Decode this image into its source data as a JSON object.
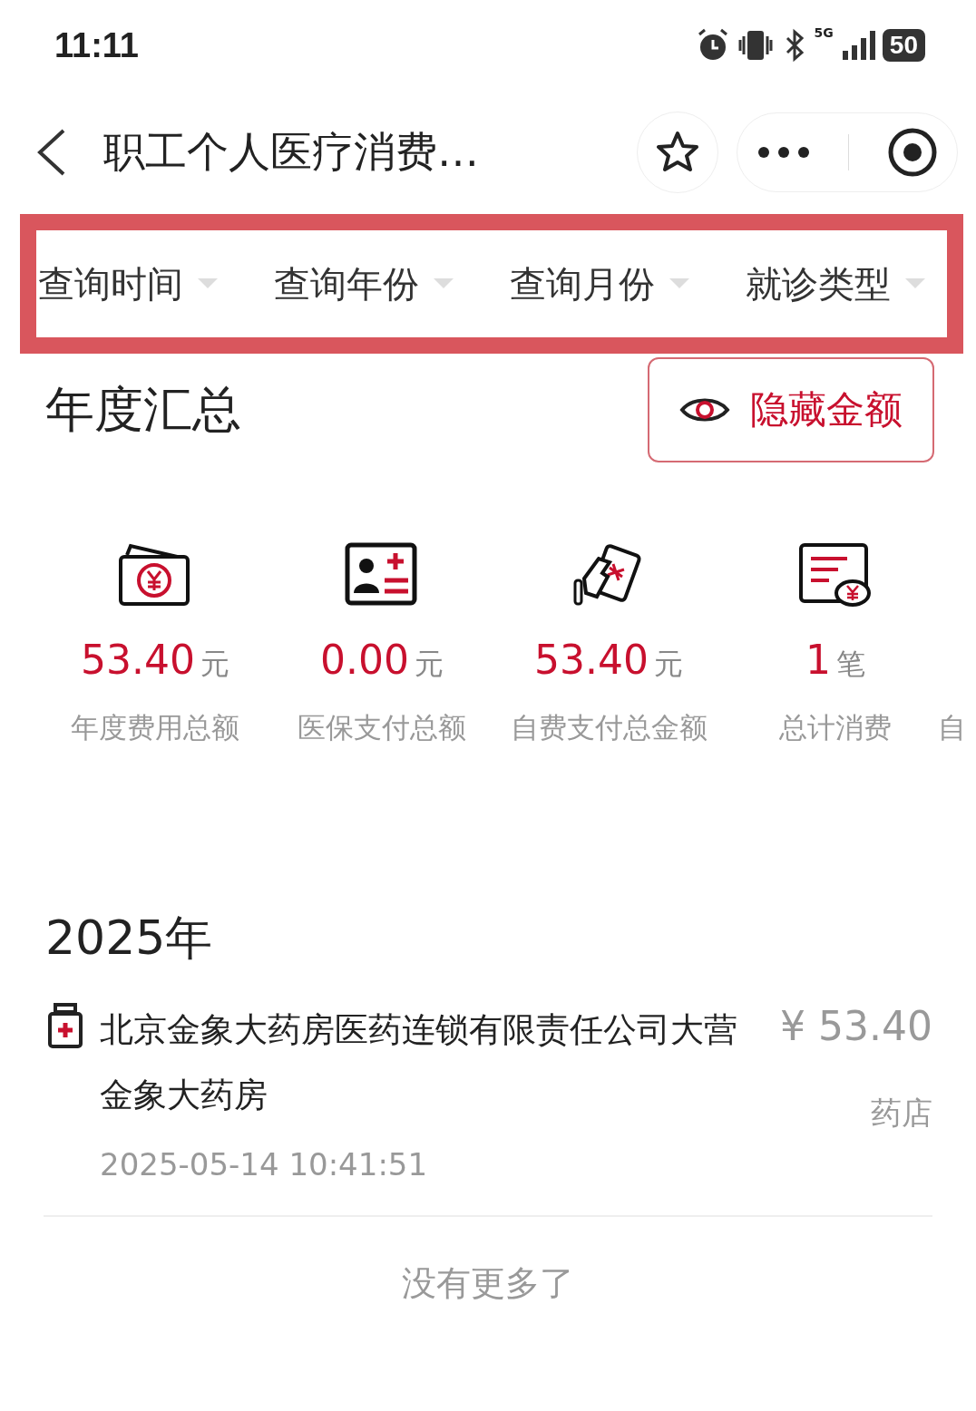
{
  "status_bar": {
    "time": "11:11",
    "battery": "50",
    "network": "5G"
  },
  "nav": {
    "title": "职工个人医疗消费…"
  },
  "filters": [
    {
      "label": "查询时间"
    },
    {
      "label": "查询年份"
    },
    {
      "label": "查询月份"
    },
    {
      "label": "就诊类型"
    }
  ],
  "summary": {
    "title": "年度汇总",
    "toggle_label": "隐藏金额",
    "stats": [
      {
        "kind": "cash",
        "value": "53.40",
        "unit": "元",
        "label": "年度费用总额"
      },
      {
        "kind": "card",
        "value": "0.00",
        "unit": "元",
        "label": "医保支付总额"
      },
      {
        "kind": "pay",
        "value": "53.40",
        "unit": "元",
        "label": "自费支付总金额"
      },
      {
        "kind": "bill",
        "value": "1",
        "unit": "笔",
        "label": "总计消费"
      },
      {
        "kind": "none",
        "label": "自"
      }
    ]
  },
  "year": "2025年",
  "records": [
    {
      "name": "北京金象大药房医药连锁有限责任公司大营金象大药房",
      "amount": "¥ 53.40",
      "type": "药店",
      "time": "2025-05-14 10:41:51"
    }
  ],
  "footer": "没有更多了"
}
